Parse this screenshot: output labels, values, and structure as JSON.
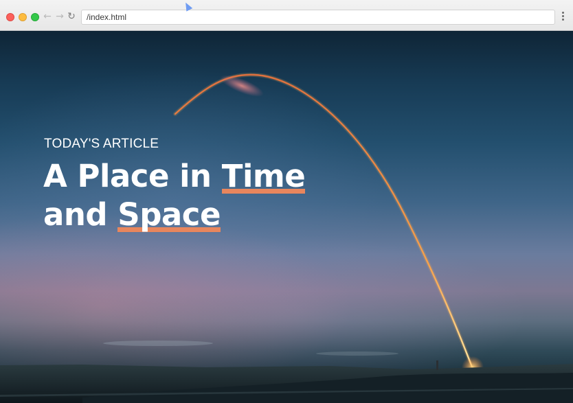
{
  "browser": {
    "url": "/index.html",
    "nav_back_glyph": "←",
    "nav_forward_glyph": "→",
    "reload_glyph": "↻",
    "traffic_lights": [
      "#fc605b",
      "#fdbc40",
      "#34c84a"
    ]
  },
  "hero": {
    "kicker": "TODAY'S ARTICLE",
    "headline": {
      "part1": "A Place in ",
      "highlight1": "Time",
      "line2_start": "and ",
      "highlight2": "Space"
    },
    "accent_color": "#e8865d"
  }
}
